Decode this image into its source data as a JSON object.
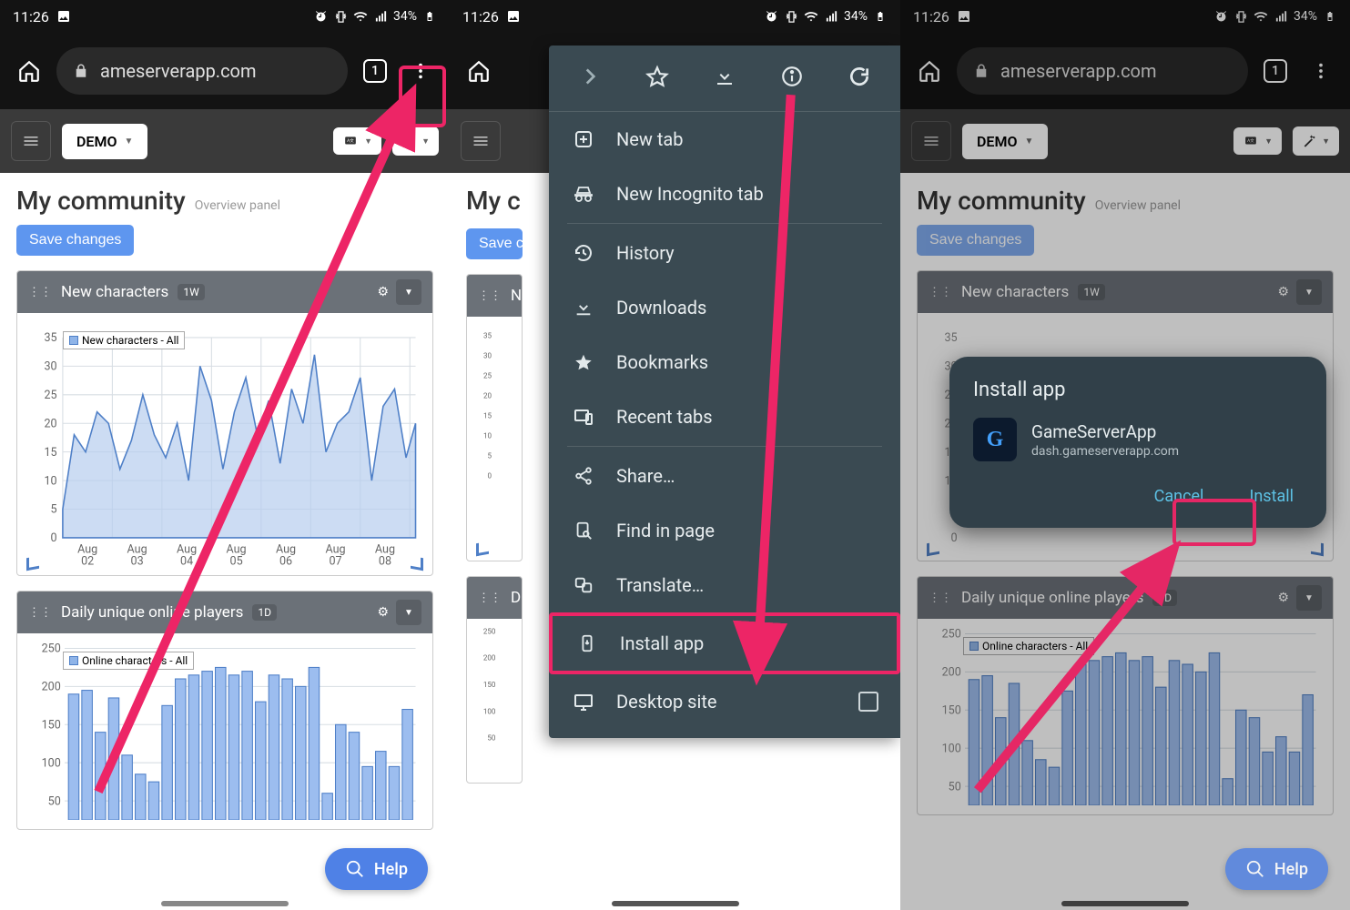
{
  "status": {
    "time": "11:26",
    "battery": "34%"
  },
  "browser": {
    "url": "ameserverapp.com",
    "tab_count": "1"
  },
  "toolbar": {
    "demo_label": "DEMO"
  },
  "page": {
    "title": "My community",
    "subtitle": "Overview panel",
    "save_label": "Save changes"
  },
  "cards": {
    "chars": {
      "title": "New characters",
      "badge": "1W",
      "legend": "New characters - All"
    },
    "players": {
      "title": "Daily unique online players",
      "badge": "1D",
      "legend": "Online characters - All"
    }
  },
  "help_label": "Help",
  "chrome_menu": {
    "new_tab": "New tab",
    "incognito": "New Incognito tab",
    "history": "History",
    "downloads": "Downloads",
    "bookmarks": "Bookmarks",
    "recent": "Recent tabs",
    "share": "Share…",
    "find": "Find in page",
    "translate": "Translate…",
    "install": "Install app",
    "desktop": "Desktop site"
  },
  "install_dialog": {
    "title": "Install app",
    "app_name": "GameServerApp",
    "app_host": "dash.gameserverapp.com",
    "cancel": "Cancel",
    "install": "Install"
  },
  "chart_data": [
    {
      "type": "line",
      "title": "New characters",
      "legend": "New characters - All",
      "ylim": [
        0,
        35
      ],
      "yticks": [
        0,
        5,
        10,
        15,
        20,
        25,
        30,
        35
      ],
      "categories": [
        "Aug 02",
        "Aug 03",
        "Aug 04",
        "Aug 05",
        "Aug 06",
        "Aug 07",
        "Aug 08"
      ],
      "series": [
        {
          "name": "New characters - All",
          "values_sampled": [
            5,
            18,
            15,
            22,
            20,
            12,
            17,
            25,
            18,
            14,
            20,
            10,
            30,
            24,
            12,
            22,
            28,
            18,
            24,
            13,
            26,
            20,
            32,
            15,
            20,
            22,
            28,
            10,
            23,
            26,
            14,
            20
          ]
        }
      ]
    },
    {
      "type": "bar",
      "title": "Daily unique online players",
      "legend": "Online characters - All",
      "ylim": [
        50,
        250
      ],
      "yticks": [
        50,
        100,
        150,
        200,
        250
      ],
      "series": [
        {
          "name": "Online characters - All",
          "values": [
            190,
            195,
            140,
            185,
            110,
            85,
            75,
            175,
            210,
            215,
            220,
            225,
            215,
            220,
            180,
            215,
            210,
            200,
            225,
            60,
            150,
            140,
            95,
            115,
            95,
            170
          ]
        }
      ]
    }
  ]
}
